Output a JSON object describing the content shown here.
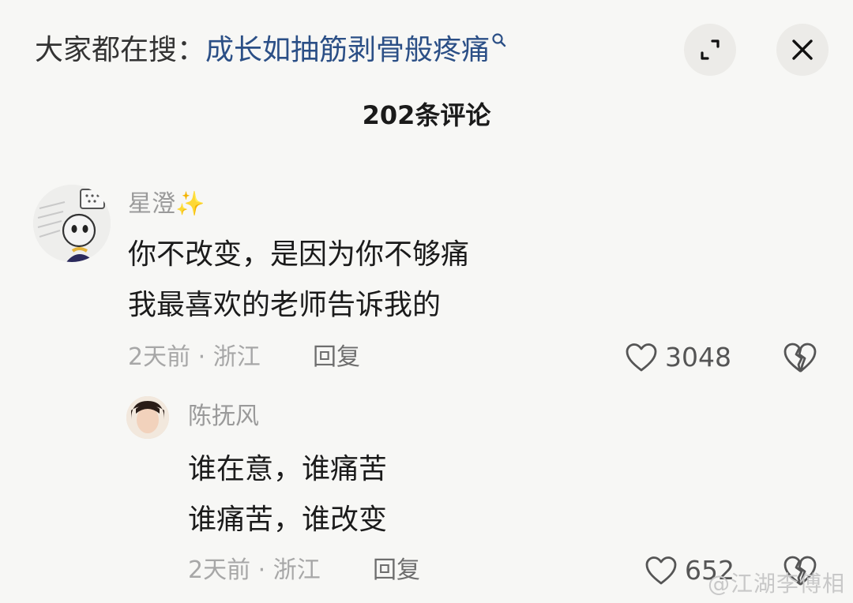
{
  "header": {
    "search_prefix": "大家都在搜：",
    "search_keyword": "成长如抽筋剥骨般疼痛",
    "expand_icon": "expand-icon",
    "close_icon": "close-icon"
  },
  "comments_title": "202条评论",
  "comments": [
    {
      "username": "星澄",
      "username_emoji": "✨",
      "lines": [
        "你不改变，是因为你不够痛",
        "我最喜欢的老师告诉我的"
      ],
      "meta": "2天前 · 浙江",
      "reply_label": "回复",
      "likes": "3048"
    },
    {
      "username": "陈抚风",
      "lines": [
        "谁在意，谁痛苦",
        "谁痛苦，谁改变"
      ],
      "meta": "2天前 · 浙江",
      "reply_label": "回复",
      "likes": "652"
    }
  ],
  "watermark": "@江湖李傅相",
  "colors": {
    "background": "#f7f7f5",
    "keyword": "#2b4f86",
    "meta_gray": "#a7a7a7"
  }
}
